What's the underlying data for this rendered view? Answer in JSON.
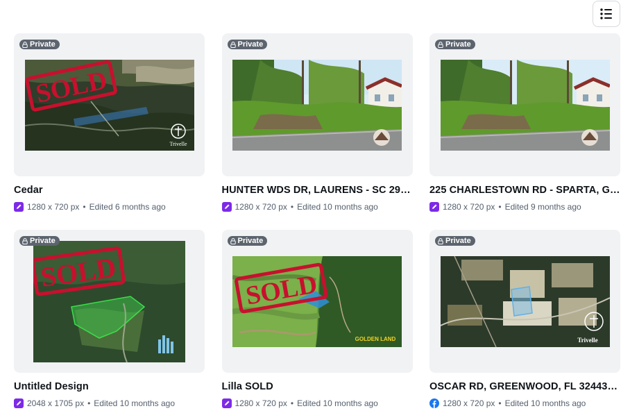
{
  "toolbar": {
    "view_toggle_icon": "list-view-icon"
  },
  "designs": [
    {
      "title": "Cedar",
      "badge": "Private",
      "dims": "1280 x 720 px",
      "edited": "Edited 6 months ago",
      "type_icon": "canva-edit-icon",
      "thumb": "aerial-sold-map"
    },
    {
      "title": "HUNTER WDS DR, LAURENS - SC 293...",
      "badge": "Private",
      "dims": "1280 x 720 px",
      "edited": "Edited 10 months ago",
      "type_icon": "canva-edit-icon",
      "thumb": "street-lot-photo"
    },
    {
      "title": "225 CHARLESTOWN RD - SPARTA, GA ...",
      "badge": "Private",
      "dims": "1280 x 720 px",
      "edited": "Edited 9 months ago",
      "type_icon": "canva-edit-icon",
      "thumb": "street-lot-photo"
    },
    {
      "title": "Untitled Design",
      "badge": "Private",
      "dims": "2048 x 1705 px",
      "edited": "Edited 10 months ago",
      "type_icon": "canva-edit-icon",
      "thumb": "forest-sold-map"
    },
    {
      "title": "Lilla SOLD",
      "badge": "Private",
      "dims": "1280 x 720 px",
      "edited": "Edited 10 months ago",
      "type_icon": "canva-edit-icon",
      "thumb": "field-sold-map"
    },
    {
      "title": "OSCAR RD, GREENWOOD, FL 32443_L...",
      "badge": "Private",
      "dims": "1280 x 720 px",
      "edited": "Edited 10 months ago",
      "type_icon": "facebook-icon",
      "thumb": "farmland-aerial-map"
    }
  ],
  "separator": "•",
  "thumb_overlays": {
    "sold_stamp": "SOLD",
    "logo_trivelle": "Trivelle",
    "logo_golden": "GOLDEN LAND"
  },
  "colors": {
    "badge_bg": "#5c646e",
    "card_bg": "#f1f2f4",
    "edit_icon": "#7d2ae8",
    "facebook": "#1877f2",
    "sold_red": "#c8102e"
  }
}
